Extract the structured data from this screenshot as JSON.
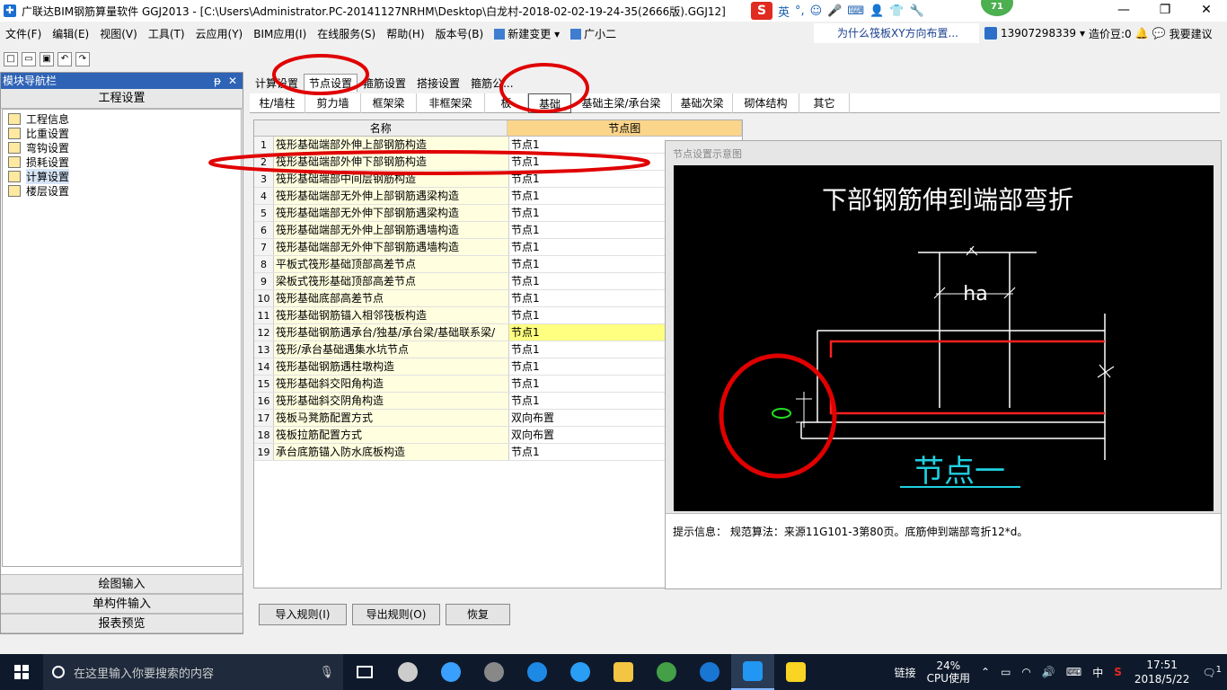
{
  "titlebar": {
    "title": "广联达BIM钢筋算量软件 GGJ2013 - [C:\\Users\\Administrator.PC-20141127NRHM\\Desktop\\白龙村-2018-02-02-19-24-35(2666版).GGJ12]",
    "ime_label": "英",
    "badge": "71",
    "minimize": "—",
    "maximize": "❐",
    "close": "✕"
  },
  "menu": {
    "items": [
      "文件(F)",
      "编辑(E)",
      "视图(V)",
      "工具(T)",
      "云应用(Y)",
      "BIM应用(I)",
      "在线服务(S)",
      "帮助(H)",
      "版本号(B)",
      "新建变更",
      "广小二"
    ],
    "ad_text": "为什么筏板XY方向布置...",
    "phone": "13907298339",
    "beans": "造价豆:0",
    "suggest": "我要建议"
  },
  "nav": {
    "header": "模块导航栏",
    "pin": "ᵽ",
    "close": "✕",
    "section_top": "工程设置",
    "tree": [
      "工程信息",
      "比重设置",
      "弯钩设置",
      "损耗设置",
      "计算设置",
      "楼层设置"
    ],
    "bottom": [
      "绘图输入",
      "单构件输入",
      "报表预览"
    ]
  },
  "tabs1": [
    "计算设置",
    "节点设置",
    "箍筋设置",
    "搭接设置",
    "箍筋公..."
  ],
  "tabs2": [
    "柱/墙柱",
    "剪力墙",
    "框架梁",
    "非框架梁",
    "板",
    "基础",
    "基础主梁/承台梁",
    "基础次梁",
    "砌体结构",
    "其它"
  ],
  "grid": {
    "header_name": "名称",
    "header_node": "节点图",
    "rows": [
      {
        "no": "1",
        "name": "筏形基础端部外伸上部钢筋构造",
        "node": "节点1"
      },
      {
        "no": "2",
        "name": "筏形基础端部外伸下部钢筋构造",
        "node": "节点1"
      },
      {
        "no": "3",
        "name": "筏形基础端部中间层钢筋构造",
        "node": "节点1"
      },
      {
        "no": "4",
        "name": "筏形基础端部无外伸上部钢筋遇梁构造",
        "node": "节点1"
      },
      {
        "no": "5",
        "name": "筏形基础端部无外伸下部钢筋遇梁构造",
        "node": "节点1"
      },
      {
        "no": "6",
        "name": "筏形基础端部无外伸上部钢筋遇墙构造",
        "node": "节点1"
      },
      {
        "no": "7",
        "name": "筏形基础端部无外伸下部钢筋遇墙构造",
        "node": "节点1"
      },
      {
        "no": "8",
        "name": "平板式筏形基础顶部高差节点",
        "node": "节点1"
      },
      {
        "no": "9",
        "name": "梁板式筏形基础顶部高差节点",
        "node": "节点1"
      },
      {
        "no": "10",
        "name": "筏形基础底部高差节点",
        "node": "节点1"
      },
      {
        "no": "11",
        "name": "筏形基础钢筋锚入相邻筏板构造",
        "node": "节点1"
      },
      {
        "no": "12",
        "name": "筏形基础钢筋遇承台/独基/承台梁/基础联系梁/",
        "node": "节点1"
      },
      {
        "no": "13",
        "name": "筏形/承台基础遇集水坑节点",
        "node": "节点1"
      },
      {
        "no": "14",
        "name": "筏形基础钢筋遇柱墩构造",
        "node": "节点1"
      },
      {
        "no": "15",
        "name": "筏形基础斜交阳角构造",
        "node": "节点1"
      },
      {
        "no": "16",
        "name": "筏形基础斜交阴角构造",
        "node": "节点1"
      },
      {
        "no": "17",
        "name": "筏板马凳筋配置方式",
        "node": "双向布置"
      },
      {
        "no": "18",
        "name": "筏板拉筋配置方式",
        "node": "双向布置"
      },
      {
        "no": "19",
        "name": "承台底筋锚入防水底板构造",
        "node": "节点1"
      }
    ]
  },
  "diagram": {
    "caption": "节点设置示意图",
    "title": "下部钢筋伸到端部弯折",
    "dim_label": "ha",
    "node_label": "节点一",
    "hint": "提示信息： 规范算法：来源11G101-3第80页。底筋伸到端部弯折12*d。"
  },
  "buttons": [
    "导入规则(I)",
    "导出规则(O)",
    "恢复"
  ],
  "taskbar": {
    "search_placeholder": "在这里输入你要搜索的内容",
    "link": "链接",
    "cpu_percent": "24%",
    "cpu_label": "CPU使用",
    "ime": "中",
    "time": "17:51",
    "date": "2018/5/22",
    "notify_count": "1"
  },
  "colors": {
    "nav_header": "#2e63b6",
    "rebar_red": "#ff2020",
    "annotation_red": "#e00000",
    "node_cyan": "#20d0e0"
  }
}
